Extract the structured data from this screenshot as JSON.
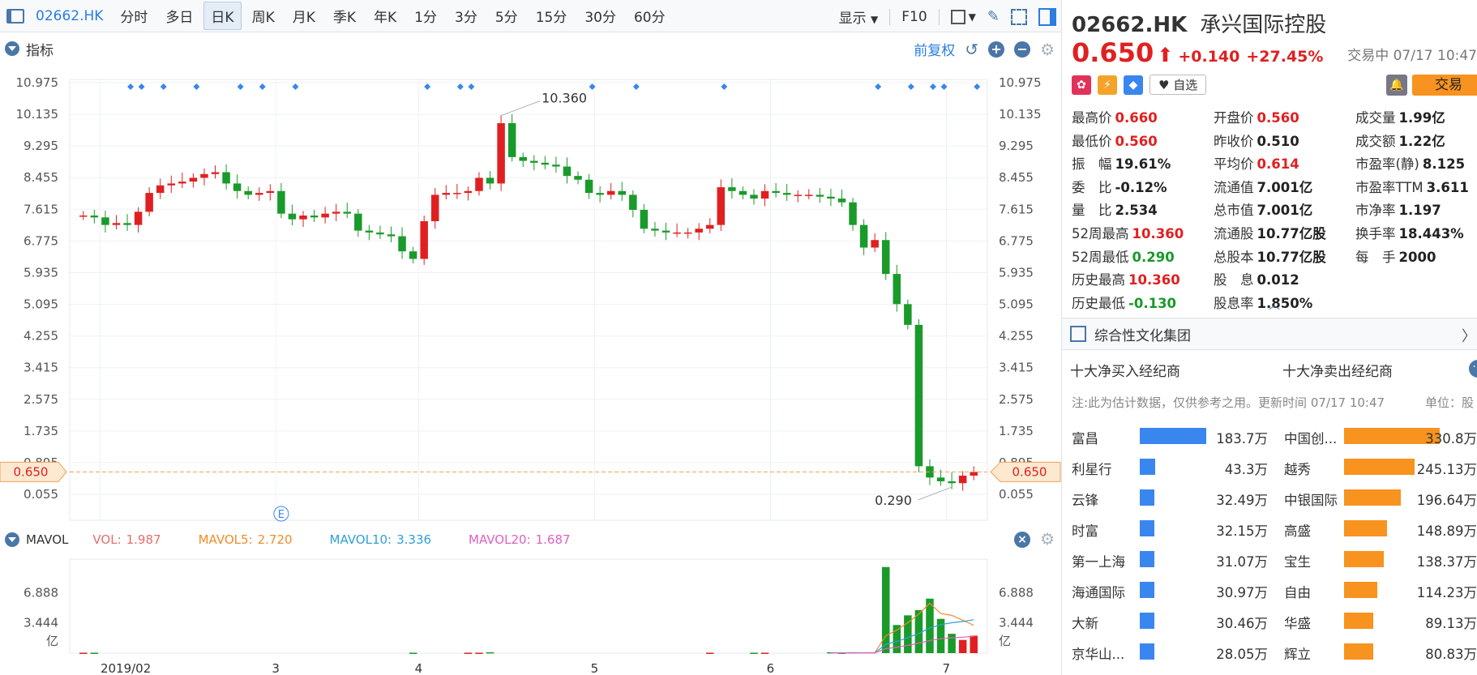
{
  "toolbar": {
    "code": "02662.HK",
    "periods": [
      "分时",
      "多日",
      "日K",
      "周K",
      "月K",
      "季K",
      "年K",
      "1分",
      "3分",
      "5分",
      "15分",
      "30分",
      "60分"
    ],
    "active_period": "日K",
    "display_label": "显示",
    "f10_label": "F10"
  },
  "indicator": {
    "label": "指标",
    "adjust_label": "前复权"
  },
  "mavol": {
    "label": "MAVOL",
    "items": [
      {
        "name": "VOL:",
        "value": "1.987",
        "color": "#e86d6d"
      },
      {
        "name": "MAVOL5:",
        "value": "2.720",
        "color": "#f08c2a"
      },
      {
        "name": "MAVOL10:",
        "value": "3.336",
        "color": "#2fa0d8"
      },
      {
        "name": "MAVOL20:",
        "value": "1.687",
        "color": "#e060c0"
      }
    ]
  },
  "chart_data": [
    {
      "type": "candlestick",
      "y_ticks": [
        "10.975",
        "10.135",
        "9.295",
        "8.455",
        "7.615",
        "6.775",
        "5.935",
        "5.095",
        "4.255",
        "3.415",
        "2.575",
        "1.735",
        "0.895",
        "0.055"
      ],
      "ylim": [
        0.055,
        10.975
      ],
      "x_ticks": [
        "2019/02",
        "3",
        "4",
        "5",
        "6",
        "7"
      ],
      "current_price_label": "0.650",
      "current_price": 0.65,
      "annotations": [
        {
          "text": "10.360",
          "value": 10.36
        },
        {
          "text": "0.290",
          "value": 0.29
        }
      ],
      "event_marker": "E",
      "closes": [
        7.45,
        7.4,
        7.2,
        7.25,
        7.2,
        7.55,
        8.05,
        8.25,
        8.3,
        8.35,
        8.45,
        8.55,
        8.6,
        8.3,
        8.1,
        8.0,
        8.05,
        8.1,
        7.5,
        7.35,
        7.45,
        7.4,
        7.5,
        7.55,
        7.5,
        7.05,
        7.0,
        6.95,
        6.9,
        6.5,
        6.3,
        7.3,
        8.0,
        8.05,
        8.05,
        8.1,
        8.45,
        8.3,
        9.9,
        9.0,
        8.9,
        8.85,
        8.8,
        8.75,
        8.5,
        8.4,
        8.05,
        8.0,
        8.1,
        8.0,
        7.6,
        7.1,
        7.05,
        7.0,
        7.0,
        7.0,
        7.1,
        7.2,
        8.2,
        8.1,
        8.0,
        7.9,
        8.1,
        8.05,
        8.0,
        8.0,
        8.0,
        7.95,
        7.9,
        7.8,
        7.2,
        6.6,
        6.8,
        5.9,
        5.1,
        4.55,
        0.8,
        0.5,
        0.4,
        0.35,
        0.55,
        0.65
      ],
      "volume_yticks": [
        "6.888",
        "3.444"
      ],
      "volume_unit": "亿",
      "volumes": [
        0.05,
        0.05,
        0.0,
        0.0,
        0.0,
        0.0,
        0.0,
        0.0,
        0.0,
        0.0,
        0.0,
        0.0,
        0.0,
        0.0,
        0.0,
        0.0,
        0.0,
        0.0,
        0.0,
        0.0,
        0.0,
        0.0,
        0.0,
        0.0,
        0.0,
        0.0,
        0.0,
        0.0,
        0.0,
        0.0,
        0.05,
        0.0,
        0.0,
        0.0,
        0.0,
        0.05,
        0.05,
        0.1,
        0.0,
        0.0,
        0.0,
        0.0,
        0.0,
        0.0,
        0.0,
        0.0,
        0.0,
        0.0,
        0.0,
        0.0,
        0.0,
        0.0,
        0.0,
        0.0,
        0.0,
        0.0,
        0.0,
        0.05,
        0.0,
        0.0,
        0.0,
        0.05,
        0.05,
        0.0,
        0.0,
        0.0,
        0.0,
        0.0,
        0.1,
        0.05,
        0.1,
        0.0,
        0.0,
        9.8,
        3.2,
        4.3,
        4.9,
        6.2,
        3.9,
        2.2,
        1.5,
        1.987
      ]
    }
  ],
  "quote": {
    "code": "02662.HK",
    "name": "承兴国际控股",
    "price": "0.650",
    "change": "+0.140",
    "change_pct": "+27.45%",
    "status_time": "交易中 07/17 10:47",
    "watch_label": "自选",
    "trade_label": "交易",
    "fields": [
      {
        "label": "最高价",
        "value": "0.660",
        "tone": "up"
      },
      {
        "label": "开盘价",
        "value": "0.560",
        "tone": "up"
      },
      {
        "label": "成交量",
        "value": "1.99亿",
        "tone": ""
      },
      {
        "label": "最低价",
        "value": "0.560",
        "tone": "up"
      },
      {
        "label": "昨收价",
        "value": "0.510",
        "tone": ""
      },
      {
        "label": "成交额",
        "value": "1.22亿",
        "tone": ""
      },
      {
        "label": "振　幅",
        "value": "19.61%",
        "tone": ""
      },
      {
        "label": "平均价",
        "value": "0.614",
        "tone": "up"
      },
      {
        "label": "市盈率(静)",
        "value": "8.125",
        "tone": ""
      },
      {
        "label": "委　比",
        "value": "-0.12%",
        "tone": ""
      },
      {
        "label": "流通值",
        "value": "7.001亿",
        "tone": ""
      },
      {
        "label": "市盈率TTM",
        "value": "3.611",
        "tone": ""
      },
      {
        "label": "量　比",
        "value": "2.534",
        "tone": ""
      },
      {
        "label": "总市值",
        "value": "7.001亿",
        "tone": ""
      },
      {
        "label": "市净率",
        "value": "1.197",
        "tone": ""
      },
      {
        "label": "52周最高",
        "value": "10.360",
        "tone": "up"
      },
      {
        "label": "流通股",
        "value": "10.77亿股",
        "tone": ""
      },
      {
        "label": "换手率",
        "value": "18.443%",
        "tone": ""
      },
      {
        "label": "52周最低",
        "value": "0.290",
        "tone": "down"
      },
      {
        "label": "总股本",
        "value": "10.77亿股",
        "tone": ""
      },
      {
        "label": "每　手",
        "value": "2000",
        "tone": ""
      },
      {
        "label": "历史最高",
        "value": "10.360",
        "tone": "up"
      },
      {
        "label": "股　息",
        "value": "0.012",
        "tone": ""
      },
      {
        "label": "",
        "value": "",
        "tone": ""
      },
      {
        "label": "历史最低",
        "value": "-0.130",
        "tone": "down"
      },
      {
        "label": "股息率",
        "value": "1.850%",
        "tone": ""
      },
      {
        "label": "",
        "value": "",
        "tone": ""
      }
    ]
  },
  "concept": {
    "name": "综合性文化集团"
  },
  "brokers": {
    "buy_title": "十大净买入经纪商",
    "sell_title": "十大净卖出经纪商",
    "note": "注:此为估计数据，仅供参考之用。更新时间 07/17 10:47",
    "unit": "单位：股",
    "buy": [
      {
        "name": "富昌",
        "value": "183.7万",
        "amount": 183.7
      },
      {
        "name": "利星行",
        "value": "43.3万",
        "amount": 43.3
      },
      {
        "name": "云锋",
        "value": "32.49万",
        "amount": 32.49
      },
      {
        "name": "时富",
        "value": "32.15万",
        "amount": 32.15
      },
      {
        "name": "第一上海",
        "value": "31.07万",
        "amount": 31.07
      },
      {
        "name": "海通国际",
        "value": "30.97万",
        "amount": 30.97
      },
      {
        "name": "大新",
        "value": "30.46万",
        "amount": 30.46
      },
      {
        "name": "京华山...",
        "value": "28.05万",
        "amount": 28.05
      }
    ],
    "sell": [
      {
        "name": "中国创...",
        "value": "330.8万",
        "amount": 330.8
      },
      {
        "name": "越秀",
        "value": "245.13万",
        "amount": 245.13
      },
      {
        "name": "中银国际",
        "value": "196.64万",
        "amount": 196.64
      },
      {
        "name": "高盛",
        "value": "148.89万",
        "amount": 148.89
      },
      {
        "name": "宝生",
        "value": "138.37万",
        "amount": 138.37
      },
      {
        "name": "自由",
        "value": "114.23万",
        "amount": 114.23
      },
      {
        "name": "华盛",
        "value": "89.13万",
        "amount": 89.13
      },
      {
        "name": "辉立",
        "value": "80.83万",
        "amount": 80.83
      }
    ]
  }
}
